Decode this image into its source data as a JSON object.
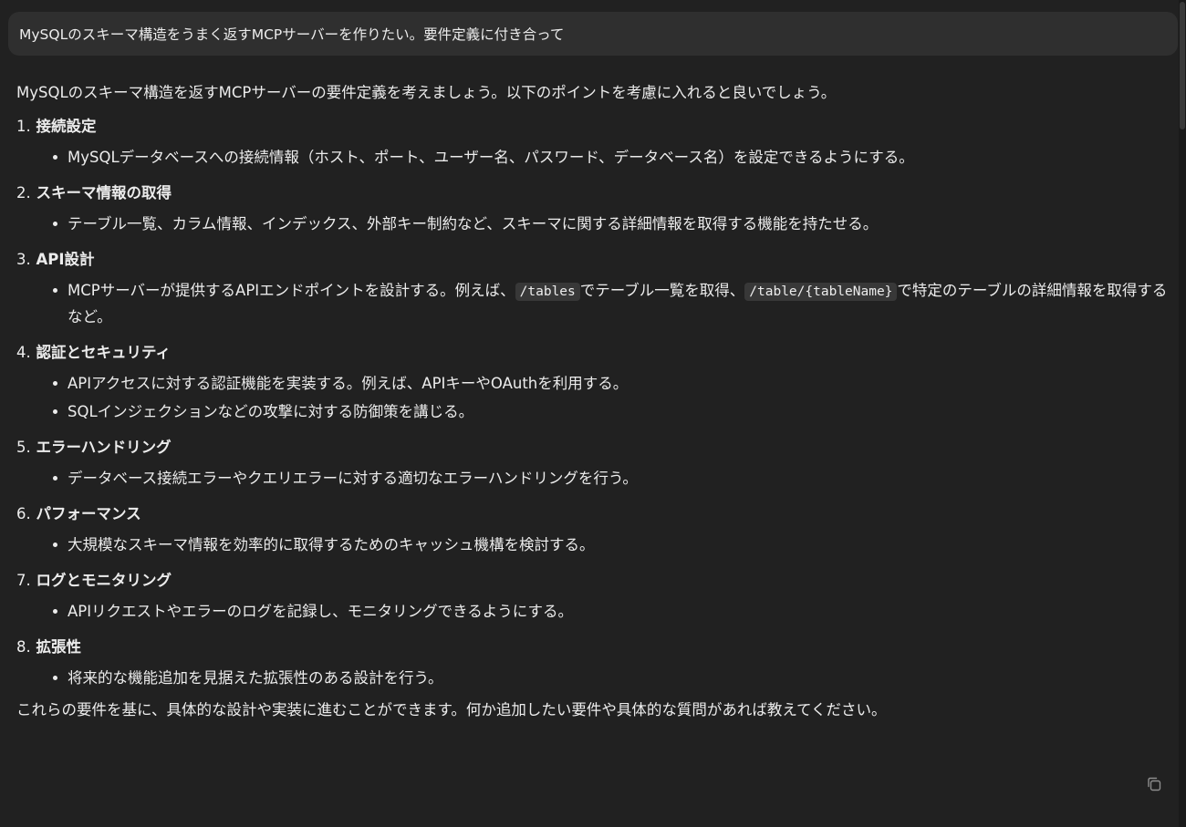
{
  "user_message": "MySQLのスキーマ構造をうまく返すMCPサーバーを作りたい。要件定義に付き合って",
  "assistant": {
    "intro": "MySQLのスキーマ構造を返すMCPサーバーの要件定義を考えましょう。以下のポイントを考慮に入れると良いでしょう。",
    "sections": [
      {
        "number": "1.",
        "title": "接続設定",
        "bullets": [
          "MySQLデータベースへの接続情報（ホスト、ポート、ユーザー名、パスワード、データベース名）を設定できるようにする。"
        ]
      },
      {
        "number": "2.",
        "title": "スキーマ情報の取得",
        "bullets": [
          "テーブル一覧、カラム情報、インデックス、外部キー制約など、スキーマに関する詳細情報を取得する機能を持たせる。"
        ]
      },
      {
        "number": "3.",
        "title": "API設計",
        "api_bullet": {
          "part1": "MCPサーバーが提供するAPIエンドポイントを設計する。例えば、",
          "code1": "/tables",
          "part2": "でテーブル一覧を取得、",
          "code2": "/table/{tableName}",
          "part3": "で特定のテーブルの詳細情報を取得するなど。"
        }
      },
      {
        "number": "4.",
        "title": "認証とセキュリティ",
        "bullets": [
          "APIアクセスに対する認証機能を実装する。例えば、APIキーやOAuthを利用する。",
          "SQLインジェクションなどの攻撃に対する防御策を講じる。"
        ]
      },
      {
        "number": "5.",
        "title": "エラーハンドリング",
        "bullets": [
          "データベース接続エラーやクエリエラーに対する適切なエラーハンドリングを行う。"
        ]
      },
      {
        "number": "6.",
        "title": "パフォーマンス",
        "bullets": [
          "大規模なスキーマ情報を効率的に取得するためのキャッシュ機構を検討する。"
        ]
      },
      {
        "number": "7.",
        "title": "ログとモニタリング",
        "bullets": [
          "APIリクエストやエラーのログを記録し、モニタリングできるようにする。"
        ]
      },
      {
        "number": "8.",
        "title": "拡張性",
        "bullets": [
          "将来的な機能追加を見据えた拡張性のある設計を行う。"
        ]
      }
    ],
    "closing": "これらの要件を基に、具体的な設計や実装に進むことができます。何か追加したい要件や具体的な質問があれば教えてください。"
  },
  "icons": {
    "copy": "copy-icon"
  },
  "colors": {
    "background": "#212121",
    "bubble": "#2f2f2f",
    "text": "#ececec",
    "code_bg": "#383838"
  }
}
